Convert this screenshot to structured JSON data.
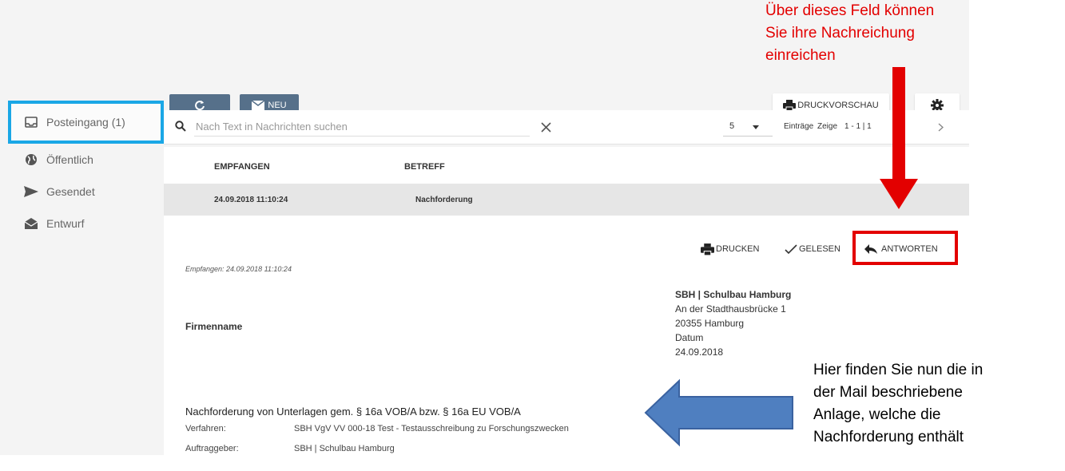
{
  "toolbar": {
    "refresh_icon": "refresh-icon",
    "new_label": "NEU",
    "print_preview_label": "DRUCKVORSCHAU"
  },
  "sidebar": {
    "items": [
      {
        "label": "Posteingang (1)",
        "icon": "inbox-icon"
      },
      {
        "label": "Öffentlich",
        "icon": "globe-icon"
      },
      {
        "label": "Gesendet",
        "icon": "send-icon"
      },
      {
        "label": "Entwurf",
        "icon": "draft-icon"
      }
    ]
  },
  "search": {
    "placeholder": "Nach Text in Nachrichten suchen"
  },
  "pagination": {
    "page_size": "5",
    "entries_label": "Einträge",
    "show_label": "Zeige",
    "range": "1 - 1 | 1"
  },
  "table": {
    "headers": [
      "EMPFANGEN",
      "BETREFF"
    ],
    "rows": [
      {
        "received": "24.09.2018 11:10:24",
        "subject": "Nachforderung"
      }
    ]
  },
  "message": {
    "actions": {
      "print": "DRUCKEN",
      "read": "GELESEN",
      "reply": "ANTWORTEN"
    },
    "received_line": "Empfangen: 24.09.2018 11:10:24",
    "sender": {
      "name": "SBH | Schulbau Hamburg",
      "street": "An der Stadthausbrücke 1",
      "city": "20355 Hamburg",
      "date_label": "Datum",
      "date": "24.09.2018"
    },
    "company_label": "Firmenname",
    "subject_line": "Nachforderung von Unterlagen gem. § 16a VOB/A bzw. § 16a EU VOB/A",
    "details": [
      {
        "key": "Verfahren:",
        "value": "SBH VgV VV 000-18 Test - Testausschreibung zu Forschungszwecken"
      },
      {
        "key": "Auftraggeber:",
        "value": "SBH | Schulbau Hamburg"
      }
    ]
  },
  "annotations": {
    "top_note": [
      "Über dieses Feld können",
      "Sie ihre Nachreichung",
      "einreichen"
    ],
    "right_note": [
      "Hier finden Sie nun die in",
      "der Mail beschriebene",
      "Anlage, welche die",
      "Nachforderung enthält"
    ]
  },
  "colors": {
    "highlight_blue": "#1aa7e6",
    "annotation_red": "#e30000",
    "arrow_blue": "#4f7fc0",
    "button_slate": "#56708a"
  }
}
